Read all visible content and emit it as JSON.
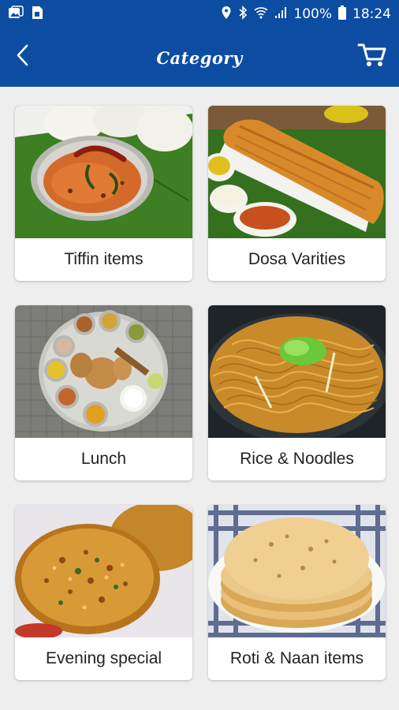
{
  "status_bar": {
    "battery_percent": "100%",
    "time": "18:24",
    "icons": [
      "gallery-icon",
      "sim-icon",
      "location-icon",
      "bluetooth-icon",
      "wifi-icon",
      "signal-icon",
      "battery-icon"
    ]
  },
  "app_bar": {
    "title": "Category",
    "back_icon": "back-arrow-icon",
    "cart_icon": "cart-icon",
    "color": "#0c4da2"
  },
  "categories": [
    {
      "label": "Tiffin items",
      "image": "idli-with-sambar"
    },
    {
      "label": "Dosa Varities",
      "image": "dosa-with-chutney"
    },
    {
      "label": "Lunch",
      "image": "thali-plate"
    },
    {
      "label": "Rice & Noodles",
      "image": "noodles"
    },
    {
      "label": "Evening special",
      "image": "vada"
    },
    {
      "label": "Roti & Naan items",
      "image": "roti-stack"
    }
  ]
}
